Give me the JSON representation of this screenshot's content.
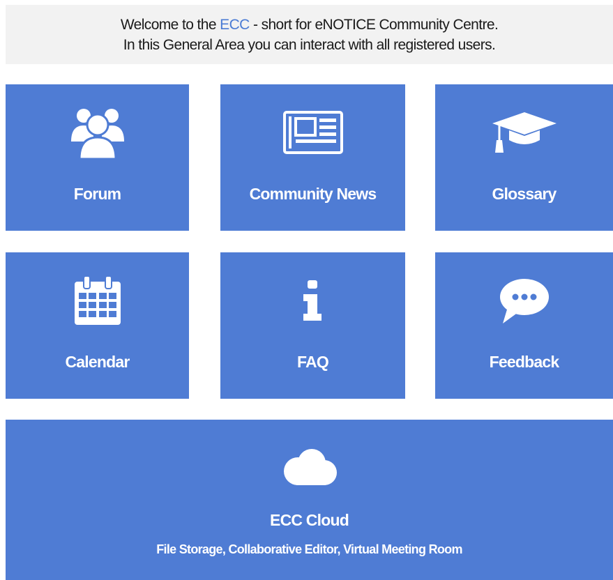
{
  "welcome": {
    "line1_prefix": "Welcome to the ",
    "line1_accent": "ECC",
    "line1_suffix": " - short for eNOTICE Community Centre.",
    "line2": "In this General Area you can interact with all registered users."
  },
  "tiles": [
    {
      "label": "Forum",
      "icon": "users-icon"
    },
    {
      "label": "Community News",
      "icon": "newspaper-icon"
    },
    {
      "label": "Glossary",
      "icon": "graduation-cap-icon"
    },
    {
      "label": "Calendar",
      "icon": "calendar-icon"
    },
    {
      "label": "FAQ",
      "icon": "info-icon"
    },
    {
      "label": "Feedback",
      "icon": "speech-bubble-icon"
    }
  ],
  "cloud": {
    "label": "ECC Cloud",
    "sub": "File Storage, Collaborative Editor, Virtual Meeting Room",
    "icon": "cloud-icon"
  },
  "colors": {
    "tile_bg": "#4f7cd4",
    "accent": "#4a7bd4",
    "banner_bg": "#f2f2f2"
  }
}
